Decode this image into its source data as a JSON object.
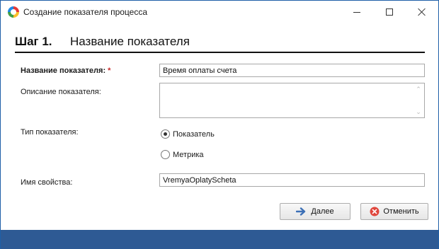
{
  "window": {
    "title": "Создание показателя процесса",
    "controls": {
      "minimize": "minimize-icon",
      "maximize": "maximize-icon",
      "close": "close-icon"
    }
  },
  "step": {
    "number": "Шаг 1.",
    "title": "Название показателя"
  },
  "form": {
    "name_label": "Название показателя:",
    "name_required_mark": "*",
    "name_value": "Время оплаты счета",
    "description_label": "Описание показателя:",
    "description_value": "",
    "type_label": "Тип показателя:",
    "type_options": [
      {
        "label": "Показатель",
        "checked": true
      },
      {
        "label": "Метрика",
        "checked": false
      }
    ],
    "property_label": "Имя свойства:",
    "property_value": "VremyaOplatyScheta"
  },
  "buttons": {
    "next_label": "Далее",
    "cancel_label": "Отменить"
  },
  "colors": {
    "accent_bar": "#2e5a94",
    "required": "#c62828",
    "next_arrow": "#3b6fb6",
    "cancel_icon": "#e0463c"
  }
}
